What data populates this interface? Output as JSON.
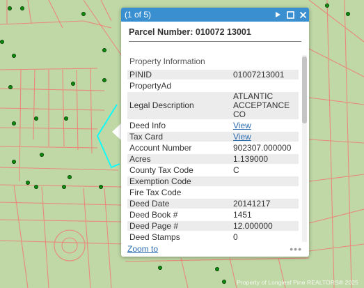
{
  "popup": {
    "counter": "(1 of 5)",
    "parcel_title": "Parcel Number: 010072 13001",
    "section_title": "Property Information",
    "rows": [
      {
        "key": "PINID",
        "value": "01007213001",
        "link": false
      },
      {
        "key": "PropertyAd",
        "value": "",
        "link": false
      },
      {
        "key": "Legal Description",
        "value": "ATLANTIC ACCEPTANCE CO",
        "link": false
      },
      {
        "key": "Deed Info",
        "value": "View",
        "link": true
      },
      {
        "key": "Tax Card",
        "value": "View",
        "link": true
      },
      {
        "key": "Account Number",
        "value": "902307.000000",
        "link": false
      },
      {
        "key": "Acres",
        "value": "1.139000",
        "link": false
      },
      {
        "key": "County Tax Code",
        "value": "C",
        "link": false
      },
      {
        "key": "Exemption Code",
        "value": "",
        "link": false
      },
      {
        "key": "Fire Tax Code",
        "value": "",
        "link": false
      },
      {
        "key": "Deed Date",
        "value": "20141217",
        "link": false
      },
      {
        "key": "Deed Book #",
        "value": "1451",
        "link": false
      },
      {
        "key": "Deed Page #",
        "value": "12.000000",
        "link": false
      },
      {
        "key": "Deed Stamps",
        "value": "0",
        "link": false
      }
    ],
    "zoom_label": "Zoom to",
    "more_label": "•••"
  },
  "watermark": "Property of Longleaf Pine REALTORS® 2025",
  "colors": {
    "map_bg": "#c0d8a6",
    "parcel_line": "#e8897a",
    "highlight": "#00ffff",
    "marker": "#0e8a0e",
    "titlebar": "#3a8fd1"
  }
}
